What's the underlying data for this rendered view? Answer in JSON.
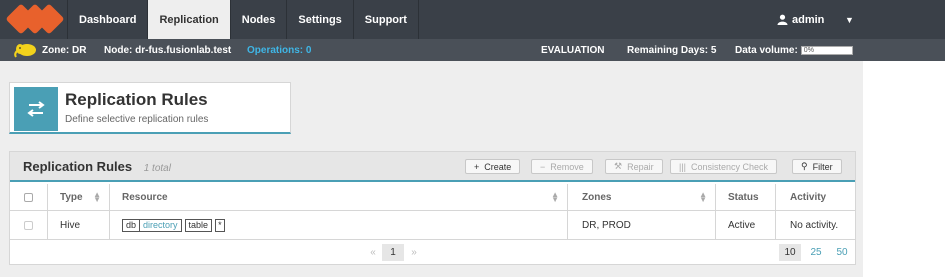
{
  "nav": {
    "tabs": [
      "Dashboard",
      "Replication",
      "Nodes",
      "Settings",
      "Support"
    ],
    "user": "admin",
    "dropdown_icon": "caret-down-icon"
  },
  "status": {
    "zone": "Zone: DR",
    "node": "Node: dr-fus.fusionlab.test",
    "operations": "Operations: 0",
    "license": "EVALUATION",
    "remaining": "Remaining Days: 5",
    "volume_label": "Data volume:",
    "volume_value": "0%"
  },
  "header": {
    "title": "Replication Rules",
    "subtitle": "Define selective replication rules"
  },
  "panel": {
    "title": "Replication Rules",
    "count": "1 total",
    "buttons": {
      "create": "Create",
      "remove": "Remove",
      "repair": "Repair",
      "check": "Consistency Check",
      "filter": "Filter"
    }
  },
  "table": {
    "columns": [
      "Type",
      "Resource",
      "Zones",
      "Status",
      "Activity"
    ],
    "rows": [
      {
        "type": "Hive",
        "tag1_key": "db",
        "tag1_val": "directory",
        "tag2_key": "table",
        "tag2_val": "*",
        "zones": "DR, PROD",
        "status": "Active",
        "activity": "No activity."
      }
    ]
  },
  "pager": {
    "prev": "«",
    "page": "1",
    "next": "»",
    "sizes": [
      "10",
      "25",
      "50"
    ]
  },
  "colors": {
    "accent": "#4a9fb5",
    "brand": "#e8612c",
    "nav_bg": "#3a4048"
  }
}
